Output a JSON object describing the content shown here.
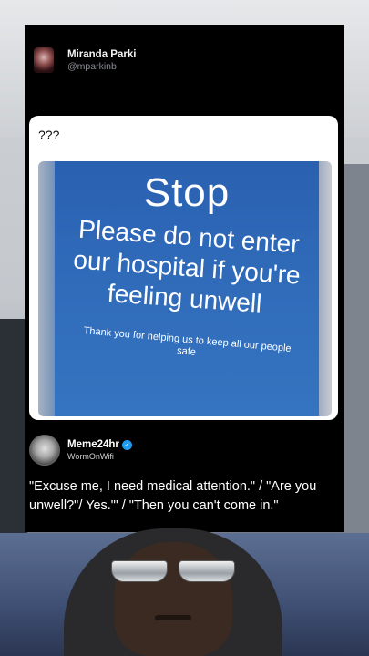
{
  "tweet": {
    "display_name": "Miranda Parki",
    "handle": "@mparkinb",
    "text": "???",
    "sign": {
      "stop": "Stop",
      "message": "Please do not enter our hospital if you're feeling unwell",
      "thanks": "Thank you for helping us to keep all our people safe"
    }
  },
  "meme": {
    "name": "Meme24hr",
    "handle": "WormOnWifi",
    "verified_icon": "verified-badge-icon",
    "caption": "\"Excuse me, I need medical attention.\" / \"Are you unwell?\"/ Yes.\"' / \"Then you can't come in.\""
  },
  "colors": {
    "card_background": "#000000",
    "sign_blue": "#2f6ab9",
    "verified_blue": "#1d9bf0"
  }
}
